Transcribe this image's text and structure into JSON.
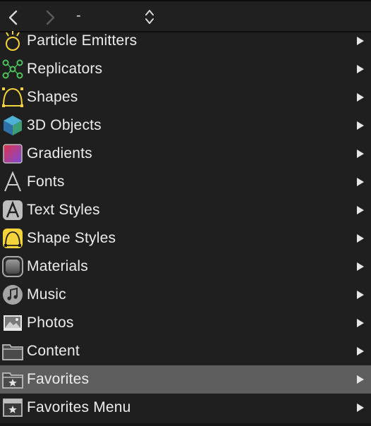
{
  "toolbar": {
    "back_label": "back",
    "forward_label": "forward",
    "path_label": "-"
  },
  "colors": {
    "background": "#1f1f1f",
    "selected_row": "#5e5e5e",
    "accent_yellow": "#f5d33a",
    "accent_green": "#4cc35b"
  },
  "items": [
    {
      "label": "Particle Emitters",
      "icon": "particle-emitter-icon"
    },
    {
      "label": "Replicators",
      "icon": "replicator-icon"
    },
    {
      "label": "Shapes",
      "icon": "shape-icon"
    },
    {
      "label": "3D Objects",
      "icon": "cube-icon"
    },
    {
      "label": "Gradients",
      "icon": "gradient-icon"
    },
    {
      "label": "Fonts",
      "icon": "font-icon"
    },
    {
      "label": "Text Styles",
      "icon": "text-style-icon"
    },
    {
      "label": "Shape Styles",
      "icon": "shape-style-icon"
    },
    {
      "label": "Materials",
      "icon": "material-icon"
    },
    {
      "label": "Music",
      "icon": "music-icon"
    },
    {
      "label": "Photos",
      "icon": "photo-icon"
    },
    {
      "label": "Content",
      "icon": "folder-icon"
    },
    {
      "label": "Favorites",
      "icon": "favorites-folder-icon",
      "selected": true
    },
    {
      "label": "Favorites Menu",
      "icon": "favorites-menu-icon"
    }
  ]
}
